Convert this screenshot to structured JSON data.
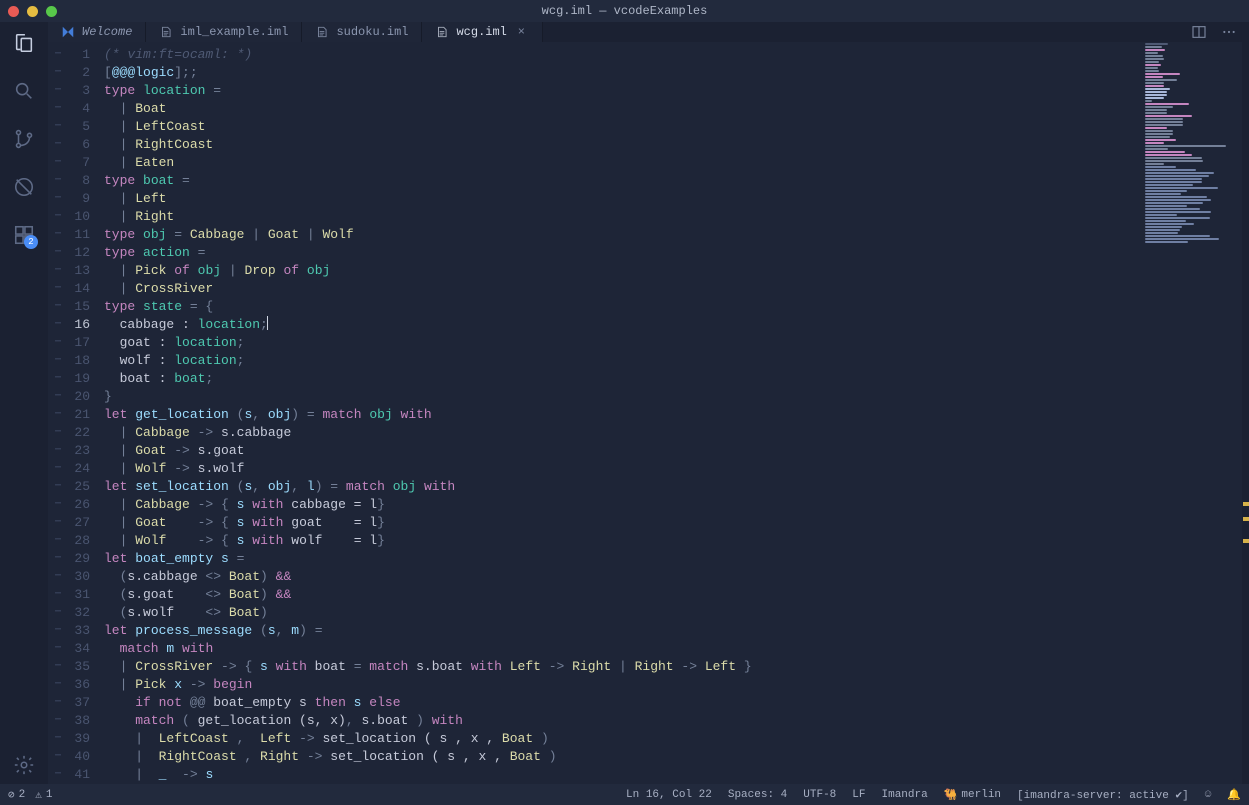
{
  "window": {
    "title": "wcg.iml — vcodeExamples"
  },
  "traffic_colors": [
    "#e95b55",
    "#e6bd41",
    "#58c84a"
  ],
  "activity": {
    "items": [
      {
        "name": "explorer-icon",
        "active": true
      },
      {
        "name": "search-icon"
      },
      {
        "name": "source-control-icon"
      },
      {
        "name": "debug-icon"
      },
      {
        "name": "extensions-icon",
        "badge": "2"
      }
    ],
    "bottom": {
      "name": "settings-icon"
    }
  },
  "tabs": [
    {
      "icon": "vscode",
      "label": "Welcome",
      "italic": true
    },
    {
      "icon": "file",
      "label": "iml_example.iml"
    },
    {
      "icon": "file",
      "label": "sudoku.iml"
    },
    {
      "icon": "file",
      "label": "wcg.iml",
      "active": true,
      "close": "×"
    }
  ],
  "status": {
    "errors_icon": "⊘",
    "errors": "2",
    "warnings_icon": "⚠",
    "warnings": "1",
    "lncol": "Ln 16, Col 22",
    "spaces": "Spaces: 4",
    "encoding": "UTF-8",
    "eol": "LF",
    "lang": "Imandra",
    "merlin_icon": "🐫",
    "merlin": "merlin",
    "server": "[imandra-server: active ✔]",
    "feedback_icon": "☺",
    "bell_icon": "🔔"
  },
  "editor": {
    "current_line": 16,
    "hint_icon": "⋯",
    "lines": [
      [
        [
          "comm",
          "(* vim:ft=ocaml: *)"
        ]
      ],
      [
        [
          "punc",
          "["
        ],
        [
          "ident",
          "@@@logic"
        ],
        [
          "punc",
          "];;"
        ]
      ],
      [
        [
          "key",
          "type "
        ],
        [
          "type",
          "location"
        ],
        [
          "punc",
          " ="
        ]
      ],
      [
        [
          "punc",
          "  | "
        ],
        [
          "ctor",
          "Boat"
        ]
      ],
      [
        [
          "punc",
          "  | "
        ],
        [
          "ctor",
          "LeftCoast"
        ]
      ],
      [
        [
          "punc",
          "  | "
        ],
        [
          "ctor",
          "RightCoast"
        ]
      ],
      [
        [
          "punc",
          "  | "
        ],
        [
          "ctor",
          "Eaten"
        ]
      ],
      [
        [
          "key",
          "type "
        ],
        [
          "type",
          "boat"
        ],
        [
          "punc",
          " ="
        ]
      ],
      [
        [
          "punc",
          "  | "
        ],
        [
          "ctor",
          "Left"
        ]
      ],
      [
        [
          "punc",
          "  | "
        ],
        [
          "ctor",
          "Right"
        ]
      ],
      [
        [
          "key",
          "type "
        ],
        [
          "type",
          "obj"
        ],
        [
          "punc",
          " = "
        ],
        [
          "ctor",
          "Cabbage"
        ],
        [
          "punc",
          " | "
        ],
        [
          "ctor",
          "Goat"
        ],
        [
          "punc",
          " | "
        ],
        [
          "ctor",
          "Wolf"
        ]
      ],
      [
        [
          "key",
          "type "
        ],
        [
          "type",
          "action"
        ],
        [
          "punc",
          " ="
        ]
      ],
      [
        [
          "punc",
          "  | "
        ],
        [
          "ctor",
          "Pick"
        ],
        [
          "key",
          " of "
        ],
        [
          "type",
          "obj"
        ],
        [
          "punc",
          " | "
        ],
        [
          "ctor",
          "Drop"
        ],
        [
          "key",
          " of "
        ],
        [
          "type",
          "obj"
        ]
      ],
      [
        [
          "punc",
          "  | "
        ],
        [
          "ctor",
          "CrossRiver"
        ]
      ],
      [
        [
          "key",
          "type "
        ],
        [
          "type",
          "state"
        ],
        [
          "punc",
          " = {"
        ]
      ],
      [
        [
          "text",
          "  cabbage : "
        ],
        [
          "type",
          "location"
        ],
        [
          "punc",
          ";"
        ],
        [
          "cursor",
          ""
        ]
      ],
      [
        [
          "text",
          "  goat : "
        ],
        [
          "type",
          "location"
        ],
        [
          "punc",
          ";"
        ]
      ],
      [
        [
          "text",
          "  wolf : "
        ],
        [
          "type",
          "location"
        ],
        [
          "punc",
          ";"
        ]
      ],
      [
        [
          "text",
          "  boat : "
        ],
        [
          "type",
          "boat"
        ],
        [
          "punc",
          ";"
        ]
      ],
      [
        [
          "punc",
          "}"
        ]
      ],
      [
        [
          "key",
          "let "
        ],
        [
          "ident",
          "get_location"
        ],
        [
          "punc",
          " ("
        ],
        [
          "ident",
          "s"
        ],
        [
          "punc",
          ", "
        ],
        [
          "ident",
          "obj"
        ],
        [
          "punc",
          ") = "
        ],
        [
          "key",
          "match "
        ],
        [
          "type",
          "obj"
        ],
        [
          "key",
          " with"
        ]
      ],
      [
        [
          "punc",
          "  | "
        ],
        [
          "ctor",
          "Cabbage"
        ],
        [
          "punc",
          " -> "
        ],
        [
          "text",
          "s.cabbage"
        ]
      ],
      [
        [
          "punc",
          "  | "
        ],
        [
          "ctor",
          "Goat"
        ],
        [
          "punc",
          " -> "
        ],
        [
          "text",
          "s.goat"
        ]
      ],
      [
        [
          "punc",
          "  | "
        ],
        [
          "ctor",
          "Wolf"
        ],
        [
          "punc",
          " -> "
        ],
        [
          "text",
          "s.wolf"
        ]
      ],
      [
        [
          "key",
          "let "
        ],
        [
          "ident",
          "set_location"
        ],
        [
          "punc",
          " ("
        ],
        [
          "ident",
          "s"
        ],
        [
          "punc",
          ", "
        ],
        [
          "ident",
          "obj"
        ],
        [
          "punc",
          ", "
        ],
        [
          "ident",
          "l"
        ],
        [
          "punc",
          ") = "
        ],
        [
          "key",
          "match "
        ],
        [
          "type",
          "obj"
        ],
        [
          "key",
          " with"
        ]
      ],
      [
        [
          "punc",
          "  | "
        ],
        [
          "ctor",
          "Cabbage"
        ],
        [
          "punc",
          " -> { "
        ],
        [
          "ident",
          "s"
        ],
        [
          "key",
          " with "
        ],
        [
          "text",
          "cabbage = l"
        ],
        [
          "punc",
          "}"
        ]
      ],
      [
        [
          "punc",
          "  | "
        ],
        [
          "ctor",
          "Goat"
        ],
        [
          "punc",
          "    -> { "
        ],
        [
          "ident",
          "s"
        ],
        [
          "key",
          " with "
        ],
        [
          "text",
          "goat    = l"
        ],
        [
          "punc",
          "}"
        ]
      ],
      [
        [
          "punc",
          "  | "
        ],
        [
          "ctor",
          "Wolf"
        ],
        [
          "punc",
          "    -> { "
        ],
        [
          "ident",
          "s"
        ],
        [
          "key",
          " with "
        ],
        [
          "text",
          "wolf    = l"
        ],
        [
          "punc",
          "}"
        ]
      ],
      [
        [
          "key",
          "let "
        ],
        [
          "ident",
          "boat_empty"
        ],
        [
          "punc",
          " "
        ],
        [
          "ident",
          "s"
        ],
        [
          "punc",
          " ="
        ]
      ],
      [
        [
          "punc",
          "  ("
        ],
        [
          "text",
          "s.cabbage "
        ],
        [
          "punc",
          "<> "
        ],
        [
          "ctor",
          "Boat"
        ],
        [
          "punc",
          ") "
        ],
        [
          "key",
          "&&"
        ]
      ],
      [
        [
          "punc",
          "  ("
        ],
        [
          "text",
          "s.goat    "
        ],
        [
          "punc",
          "<> "
        ],
        [
          "ctor",
          "Boat"
        ],
        [
          "punc",
          ") "
        ],
        [
          "key",
          "&&"
        ]
      ],
      [
        [
          "punc",
          "  ("
        ],
        [
          "text",
          "s.wolf    "
        ],
        [
          "punc",
          "<> "
        ],
        [
          "ctor",
          "Boat"
        ],
        [
          "punc",
          ")"
        ]
      ],
      [
        [
          "key",
          "let "
        ],
        [
          "ident",
          "process_message"
        ],
        [
          "punc",
          " ("
        ],
        [
          "ident",
          "s"
        ],
        [
          "punc",
          ", "
        ],
        [
          "ident",
          "m"
        ],
        [
          "punc",
          ") ="
        ]
      ],
      [
        [
          "key",
          "  match "
        ],
        [
          "ident",
          "m"
        ],
        [
          "key",
          " with"
        ]
      ],
      [
        [
          "punc",
          "  | "
        ],
        [
          "ctor",
          "CrossRiver"
        ],
        [
          "punc",
          " -> { "
        ],
        [
          "ident",
          "s"
        ],
        [
          "key",
          " with "
        ],
        [
          "text",
          "boat"
        ],
        [
          "punc",
          " = "
        ],
        [
          "key",
          "match "
        ],
        [
          "text",
          "s.boat"
        ],
        [
          "key",
          " with "
        ],
        [
          "ctor",
          "Left"
        ],
        [
          "punc",
          " -> "
        ],
        [
          "ctor",
          "Right"
        ],
        [
          "punc",
          " | "
        ],
        [
          "ctor",
          "Right"
        ],
        [
          "punc",
          " -> "
        ],
        [
          "ctor",
          "Left"
        ],
        [
          "punc",
          " }"
        ]
      ],
      [
        [
          "punc",
          "  | "
        ],
        [
          "ctor",
          "Pick"
        ],
        [
          "punc",
          " "
        ],
        [
          "ident",
          "x"
        ],
        [
          "punc",
          " -> "
        ],
        [
          "key",
          "begin"
        ]
      ],
      [
        [
          "key",
          "    if "
        ],
        [
          "key",
          "not"
        ],
        [
          "punc",
          " @@ "
        ],
        [
          "text",
          "boat_empty s"
        ],
        [
          "key",
          " then "
        ],
        [
          "ident",
          "s"
        ],
        [
          "key",
          " else"
        ]
      ],
      [
        [
          "key",
          "    match"
        ],
        [
          "punc",
          " ( "
        ],
        [
          "text",
          "get_location (s, x)"
        ],
        [
          "punc",
          ", "
        ],
        [
          "text",
          "s.boat"
        ],
        [
          "punc",
          " ) "
        ],
        [
          "key",
          "with"
        ]
      ],
      [
        [
          "punc",
          "    |  "
        ],
        [
          "ctor",
          "LeftCoast"
        ],
        [
          "punc",
          " ,  "
        ],
        [
          "ctor",
          "Left"
        ],
        [
          "punc",
          " -> "
        ],
        [
          "text",
          "set_location ( s , x , "
        ],
        [
          "ctor",
          "Boat"
        ],
        [
          "punc",
          " )"
        ]
      ],
      [
        [
          "punc",
          "    |  "
        ],
        [
          "ctor",
          "RightCoast"
        ],
        [
          "punc",
          " , "
        ],
        [
          "ctor",
          "Right"
        ],
        [
          "punc",
          " -> "
        ],
        [
          "text",
          "set_location ( s , x , "
        ],
        [
          "ctor",
          "Boat"
        ],
        [
          "punc",
          " )"
        ]
      ],
      [
        [
          "punc",
          "    |  "
        ],
        [
          "ident",
          "_"
        ],
        [
          "punc",
          "  -> "
        ],
        [
          "ident",
          "s"
        ]
      ]
    ]
  }
}
